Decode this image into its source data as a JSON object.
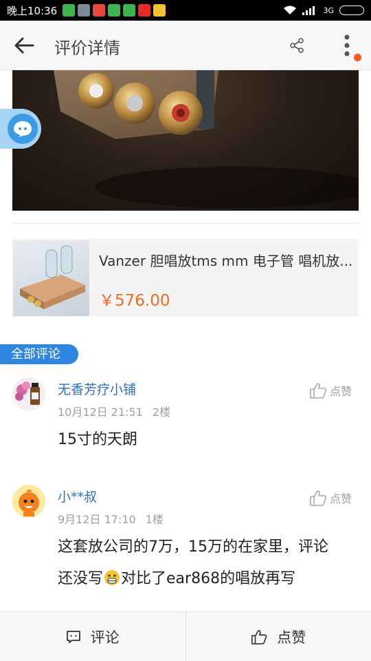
{
  "status_bar": {
    "time": "晚上10:36",
    "network": "3G"
  },
  "header": {
    "title": "评价详情"
  },
  "product": {
    "name": "Vanzer 胆唱放tms mm 电子管 唱机放...",
    "price": "￥576.00"
  },
  "section": {
    "label": "全部评论"
  },
  "comments": [
    {
      "user": "无香芳疗小铺",
      "date": "10月12日 21:51",
      "floor": "2楼",
      "like_label": "点赞",
      "text": "15寸的天朗"
    },
    {
      "user": "小**叔",
      "date": "9月12日 17:10",
      "floor": "1楼",
      "like_label": "点赞",
      "text_line1": "这套放公司的7万，15万的在家里，评论",
      "text_line2a": "还没写",
      "text_line2b": "对比了ear868的唱放再写"
    }
  ],
  "bottom_bar": {
    "comment_label": "评论",
    "like_label": "点赞"
  },
  "colors": {
    "accent_blue": "#2f86e0",
    "price_orange": "#f56a1f",
    "username_blue": "#2f6fb5"
  }
}
